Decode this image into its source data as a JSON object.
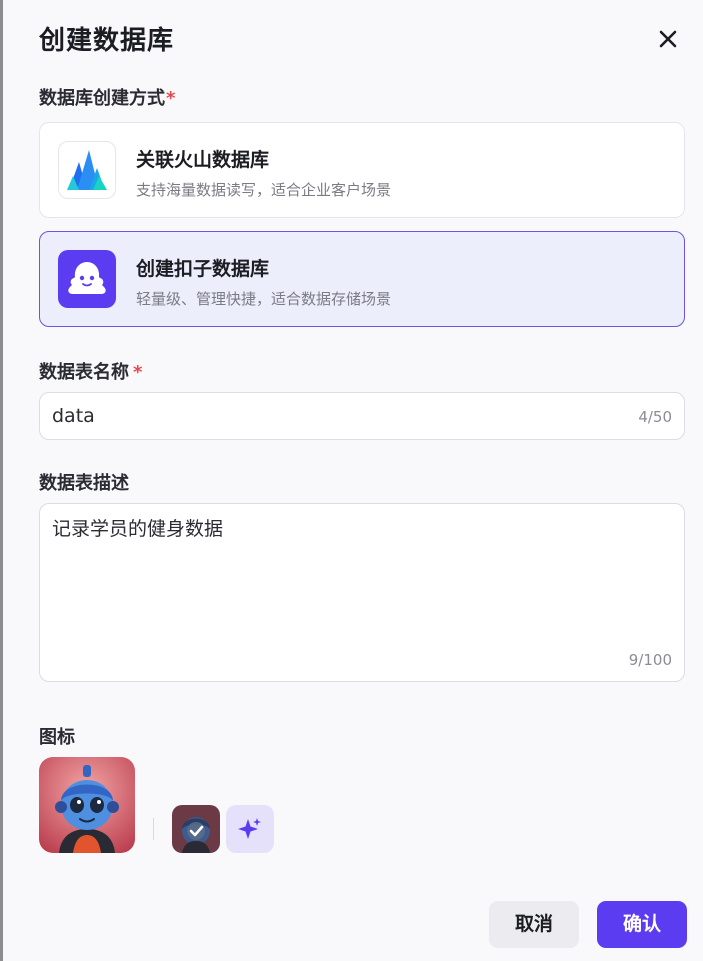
{
  "dialog": {
    "title": "创建数据库",
    "close_icon": "close-icon"
  },
  "method": {
    "label": "数据库创建方式",
    "required_mark": "*",
    "options": [
      {
        "name": "关联火山数据库",
        "desc": "支持海量数据读写，适合企业客户场景",
        "icon": "volcano-logo-icon",
        "selected": false
      },
      {
        "name": "创建扣子数据库",
        "desc": "轻量级、管理快捷，适合数据存储场景",
        "icon": "coze-ghost-logo-icon",
        "selected": true
      }
    ]
  },
  "table_name": {
    "label": "数据表名称",
    "required_mark": "*",
    "value": "data",
    "counter": "4/50"
  },
  "table_desc": {
    "label": "数据表描述",
    "value": "记录学员的健身数据",
    "counter": "9/100"
  },
  "icon_section": {
    "label": "图标",
    "current_icon": "robot-avatar-icon",
    "option_icon": "robot-avatar-selected-icon",
    "ai_generate_icon": "sparkle-icon"
  },
  "footer": {
    "cancel_label": "取消",
    "confirm_label": "确认"
  },
  "colors": {
    "accent": "#5b3cf0",
    "selected_border": "#6b55e0",
    "selected_bg": "#eceefb",
    "required": "#e5484d"
  }
}
